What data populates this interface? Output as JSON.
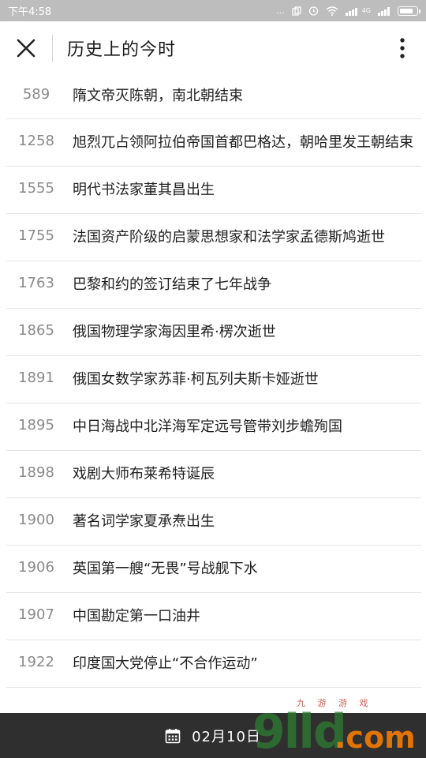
{
  "status_bar": {
    "time": "下午4:58",
    "dots": "...",
    "signal_label": "4G",
    "battery_level": 0.85
  },
  "header": {
    "title": "历史上的今时"
  },
  "events": [
    {
      "year": "589",
      "text": "隋文帝灭陈朝，南北朝结束"
    },
    {
      "year": "1258",
      "text": "旭烈兀占领阿拉伯帝国首都巴格达，朝哈里发王朝结束"
    },
    {
      "year": "1555",
      "text": "明代书法家董其昌出生"
    },
    {
      "year": "1755",
      "text": "法国资产阶级的启蒙思想家和法学家孟德斯鸠逝世"
    },
    {
      "year": "1763",
      "text": "巴黎和约的签订结束了七年战争"
    },
    {
      "year": "1865",
      "text": "俄国物理学家海因里希·楞次逝世"
    },
    {
      "year": "1891",
      "text": "俄国女数学家苏菲·柯瓦列夫斯卡娅逝世"
    },
    {
      "year": "1895",
      "text": "中日海战中北洋海军定远号管带刘步蟾殉国"
    },
    {
      "year": "1898",
      "text": "戏剧大师布莱希特诞辰"
    },
    {
      "year": "1900",
      "text": "著名词学家夏承焘出生"
    },
    {
      "year": "1906",
      "text": "英国第一艘“无畏”号战舰下水"
    },
    {
      "year": "1907",
      "text": "中国勘定第一口油井"
    },
    {
      "year": "1922",
      "text": "印度国大党停止“不合作运动”"
    }
  ],
  "bottom_bar": {
    "date": "02月10日"
  },
  "watermark": {
    "big": "9lld",
    "com": ".com",
    "small": "九 游 游 戏"
  },
  "colors": {
    "status_bg": "#bdbdbd",
    "bottom_bg": "#2f2f2f",
    "divider": "#e5e5e5",
    "year_text": "#8a8a8a"
  }
}
